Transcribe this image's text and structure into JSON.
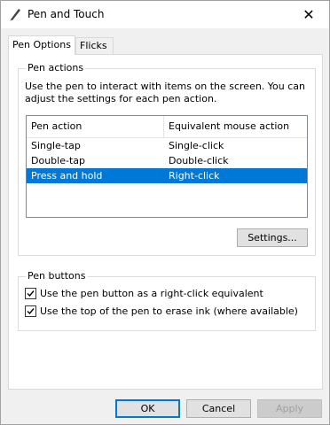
{
  "window": {
    "title": "Pen and Touch",
    "icon": "pen-icon",
    "close_glyph": "✕"
  },
  "tabs": [
    {
      "label": "Pen Options",
      "active": true
    },
    {
      "label": "Flicks",
      "active": false
    }
  ],
  "pen_actions": {
    "group_label": "Pen actions",
    "description": "Use the pen to interact with items on the screen.  You can adjust the settings for each pen action.",
    "columns": [
      "Pen action",
      "Equivalent mouse action"
    ],
    "rows": [
      {
        "action": "Single-tap",
        "mouse": "Single-click",
        "selected": false
      },
      {
        "action": "Double-tap",
        "mouse": "Double-click",
        "selected": false
      },
      {
        "action": "Press and hold",
        "mouse": "Right-click",
        "selected": true
      }
    ],
    "settings_label": "Settings..."
  },
  "pen_buttons": {
    "group_label": "Pen buttons",
    "options": [
      {
        "label": "Use the pen button as a right-click equivalent",
        "checked": true
      },
      {
        "label": "Use the top of the pen to erase ink (where available)",
        "checked": true
      }
    ]
  },
  "footer": {
    "ok_label": "OK",
    "cancel_label": "Cancel",
    "apply_label": "Apply"
  },
  "colors": {
    "selection": "#0078d7",
    "window_bg": "#f0f0f0"
  }
}
